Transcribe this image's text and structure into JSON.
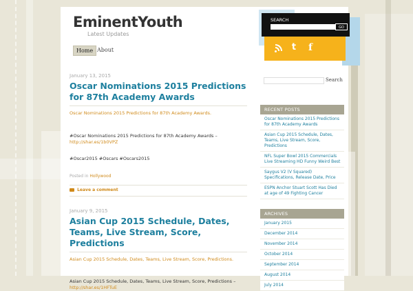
{
  "site": {
    "title": "EminentYouth",
    "tagline": "Latest Updates"
  },
  "nav": {
    "items": [
      "Home",
      "About"
    ]
  },
  "posts": [
    {
      "date": "January 13, 2015",
      "title": "Oscar Nominations 2015 Predictions for 87th Academy Awards",
      "excerpt": "Oscar Nominations 2015 Predictions for 87th Academy Awards.",
      "body_line": "#Oscar Nominations 2015 Predictions for 87th Academy Awards –",
      "body_link": "http://shar.es/1b0VPZ",
      "hashtags": "#Oscar2015 #Oscars #Oscars2015",
      "posted_in_label": "Posted in",
      "category": "Hollywood",
      "comment_link": "Leave a comment"
    },
    {
      "date": "January 9, 2015",
      "title": "Asian Cup 2015 Schedule, Dates, Teams, Live Stream, Score, Predictions",
      "excerpt": "Asian Cup 2015 Schedule, Dates, Teams, Live Stream, Score, Predictions.",
      "body_line": "Asian Cup 2015 Schedule, Dates, Teams, Live Stream, Score, Predictions –",
      "body_link": "http://shar.es/1HFTuE"
    }
  ],
  "sidebar": {
    "search_label": "SEARCH",
    "search_go": "GO",
    "social_icons": [
      "rss-icon",
      "twitter-icon",
      "facebook-icon"
    ],
    "social_glyphs": {
      "twitter": "t",
      "facebook": "f"
    },
    "search_button": "Search",
    "recent_posts": {
      "title": "RECENT POSTS",
      "items": [
        "Oscar Nominations 2015 Predictions for 87th Academy Awards",
        "Asian Cup 2015 Schedule, Dates, Teams, Live Stream, Score, Predictions",
        "NFL Super Bowl 2015 Commercials Live Streaming HD Funny Weird Best",
        "Saygus V2 (V Squared) Specifications, Release Date, Price",
        "ESPN Anchor Stuart Scott Has Died at age of 49 Fighting Cancer"
      ]
    },
    "archives": {
      "title": "ARCHIVES",
      "items": [
        "January 2015",
        "December 2014",
        "November 2014",
        "October 2014",
        "September 2014",
        "August 2014",
        "July 2014"
      ]
    }
  },
  "colors": {
    "link_blue": "#1d7f9e",
    "accent_orange": "#d08a1a",
    "social_yellow": "#f6b21b",
    "widget_head": "#a8a592",
    "background": "#e9e6d8"
  }
}
